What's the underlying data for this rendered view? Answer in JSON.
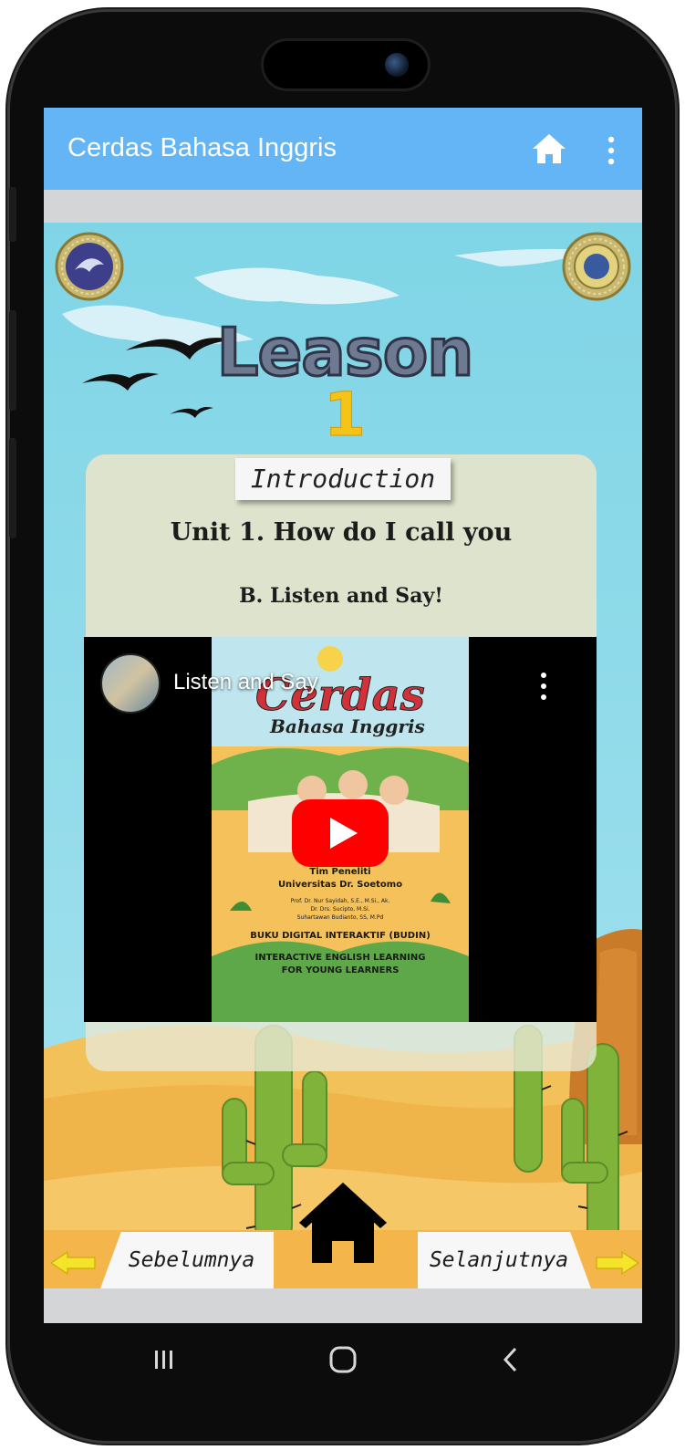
{
  "app_bar": {
    "title": "Cerdas Bahasa Inggris",
    "home_icon": "home-icon",
    "menu_icon": "more-vert-icon",
    "color": "#64b5f6"
  },
  "lesson": {
    "word": "Leason",
    "number": "1"
  },
  "card": {
    "tab_label": "Introduction",
    "unit_title": "Unit 1. How do I call you",
    "section_title": "B. Listen and Say!"
  },
  "video": {
    "title": "Listen and Say",
    "menu_icon": "more-vert-icon",
    "play_icon": "youtube-play-icon",
    "thumbnail": {
      "title_line1": "Cerdas",
      "title_line2": "Bahasa Inggris",
      "team": "Tim Peneliti",
      "university": "Universitas Dr. Soetomo",
      "authors_line1": "Prof. Dr. Nur Sayidah, S.E., M.Si., Ak.",
      "authors_line2": "Dr. Drs. Sucipto, M.Si.",
      "authors_line3": "Suhartawan Budianto, SS, M.Pd",
      "book": "BUKU DIGITAL INTERAKTIF (BUDIN)",
      "subtitle_line1": "INTERACTIVE ENGLISH LEARNING",
      "subtitle_line2": "FOR YOUNG LEARNERS"
    }
  },
  "navigation": {
    "prev_label": "Sebelumnya",
    "next_label": "Selanjutnya",
    "home_icon": "home-icon",
    "arrow_color": "#f4e52a"
  },
  "system_nav": {
    "recent_icon": "recent-apps-icon",
    "home_icon": "home-circle-icon",
    "back_icon": "back-icon"
  }
}
